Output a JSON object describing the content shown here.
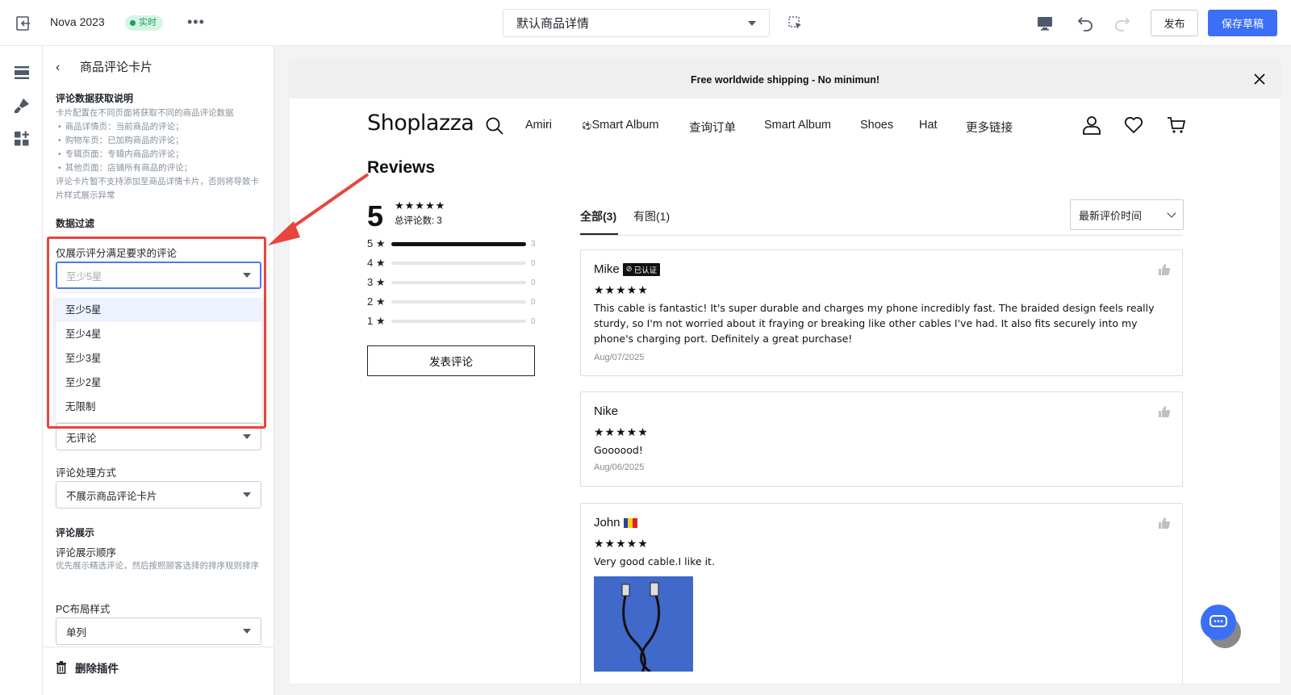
{
  "topbar": {
    "app_name": "Nova 2023",
    "live_badge": "实时",
    "more_icon": "•••",
    "template_select": "默认商品详情",
    "publish_label": "发布",
    "save_label": "保存草稿"
  },
  "panel": {
    "back_icon": "‹",
    "title": "商品评论卡片",
    "info_title": "评论数据获取说明",
    "info_intro": "卡片配置在不同页面将获取不同的商品评论数据",
    "info_items": [
      "商品详情页：当前商品的评论；",
      "购物车页：已加购商品的评论；",
      "专辑页面：专辑内商品的评论；",
      "其他页面：店铺所有商品的评论；"
    ],
    "info_warning": "评论卡片暂不支持添加至商品详情卡片，否则将导致卡片样式展示异常",
    "filter_section": "数据过滤",
    "rating_filter_label": "仅展示评分满足要求的评论",
    "rating_filter_placeholder": "至少5星",
    "rating_options": [
      "至少5星",
      "至少4星",
      "至少3星",
      "至少2星",
      "无限制"
    ],
    "no_review_value": "无评论",
    "handling_label": "评论处理方式",
    "handling_value": "不展示商品评论卡片",
    "display_section": "评论展示",
    "order_label": "评论展示顺序",
    "order_desc": "优先展示精选评论，然后按照顾客选择的排序规则排序",
    "pc_layout_label": "PC布局样式",
    "pc_layout_value": "单列",
    "delete_label": "删除插件"
  },
  "preview": {
    "announcement": "Free worldwide shipping - No minimun!",
    "logo": "Shoplazza",
    "nav_links": [
      "Amiri",
      "Smart Album",
      "查询订单",
      "Smart Album",
      "Shoes",
      "Hat",
      "更多链接"
    ],
    "reviews_title": "Reviews",
    "average_rating": "5",
    "summary_stars": "★★★★★",
    "total_reviews": "总评论数: 3",
    "distribution": [
      {
        "label": "5 ★",
        "count": "3",
        "fraction": 1.0
      },
      {
        "label": "4 ★",
        "count": "0",
        "fraction": 0
      },
      {
        "label": "3 ★",
        "count": "0",
        "fraction": 0
      },
      {
        "label": "2 ★",
        "count": "0",
        "fraction": 0
      },
      {
        "label": "1 ★",
        "count": "0",
        "fraction": 0
      }
    ],
    "write_review": "发表评论",
    "tabs": [
      "全部(3)",
      "有图(1)"
    ],
    "sort_value": "最新评价时间",
    "reviews": [
      {
        "name": "Mike",
        "badge": "已认证",
        "stars": "★★★★★",
        "text": "This cable is fantastic! It's super durable and charges my phone incredibly fast. The braided design feels really sturdy, so I'm not worried about it fraying or breaking like other cables I've had. It also fits securely into my phone's charging port. Definitely a great purchase!",
        "date": "Aug/07/2025"
      },
      {
        "name": "Nike",
        "stars": "★★★★★",
        "text": "Goooood!",
        "date": "Aug/06/2025"
      },
      {
        "name": "John",
        "stars": "★★★★★",
        "text": "Very good cable.I like it."
      }
    ]
  },
  "colors": {
    "accent": "#3b6ff5",
    "annotation": "#e8453c",
    "live": "#13a35b"
  }
}
